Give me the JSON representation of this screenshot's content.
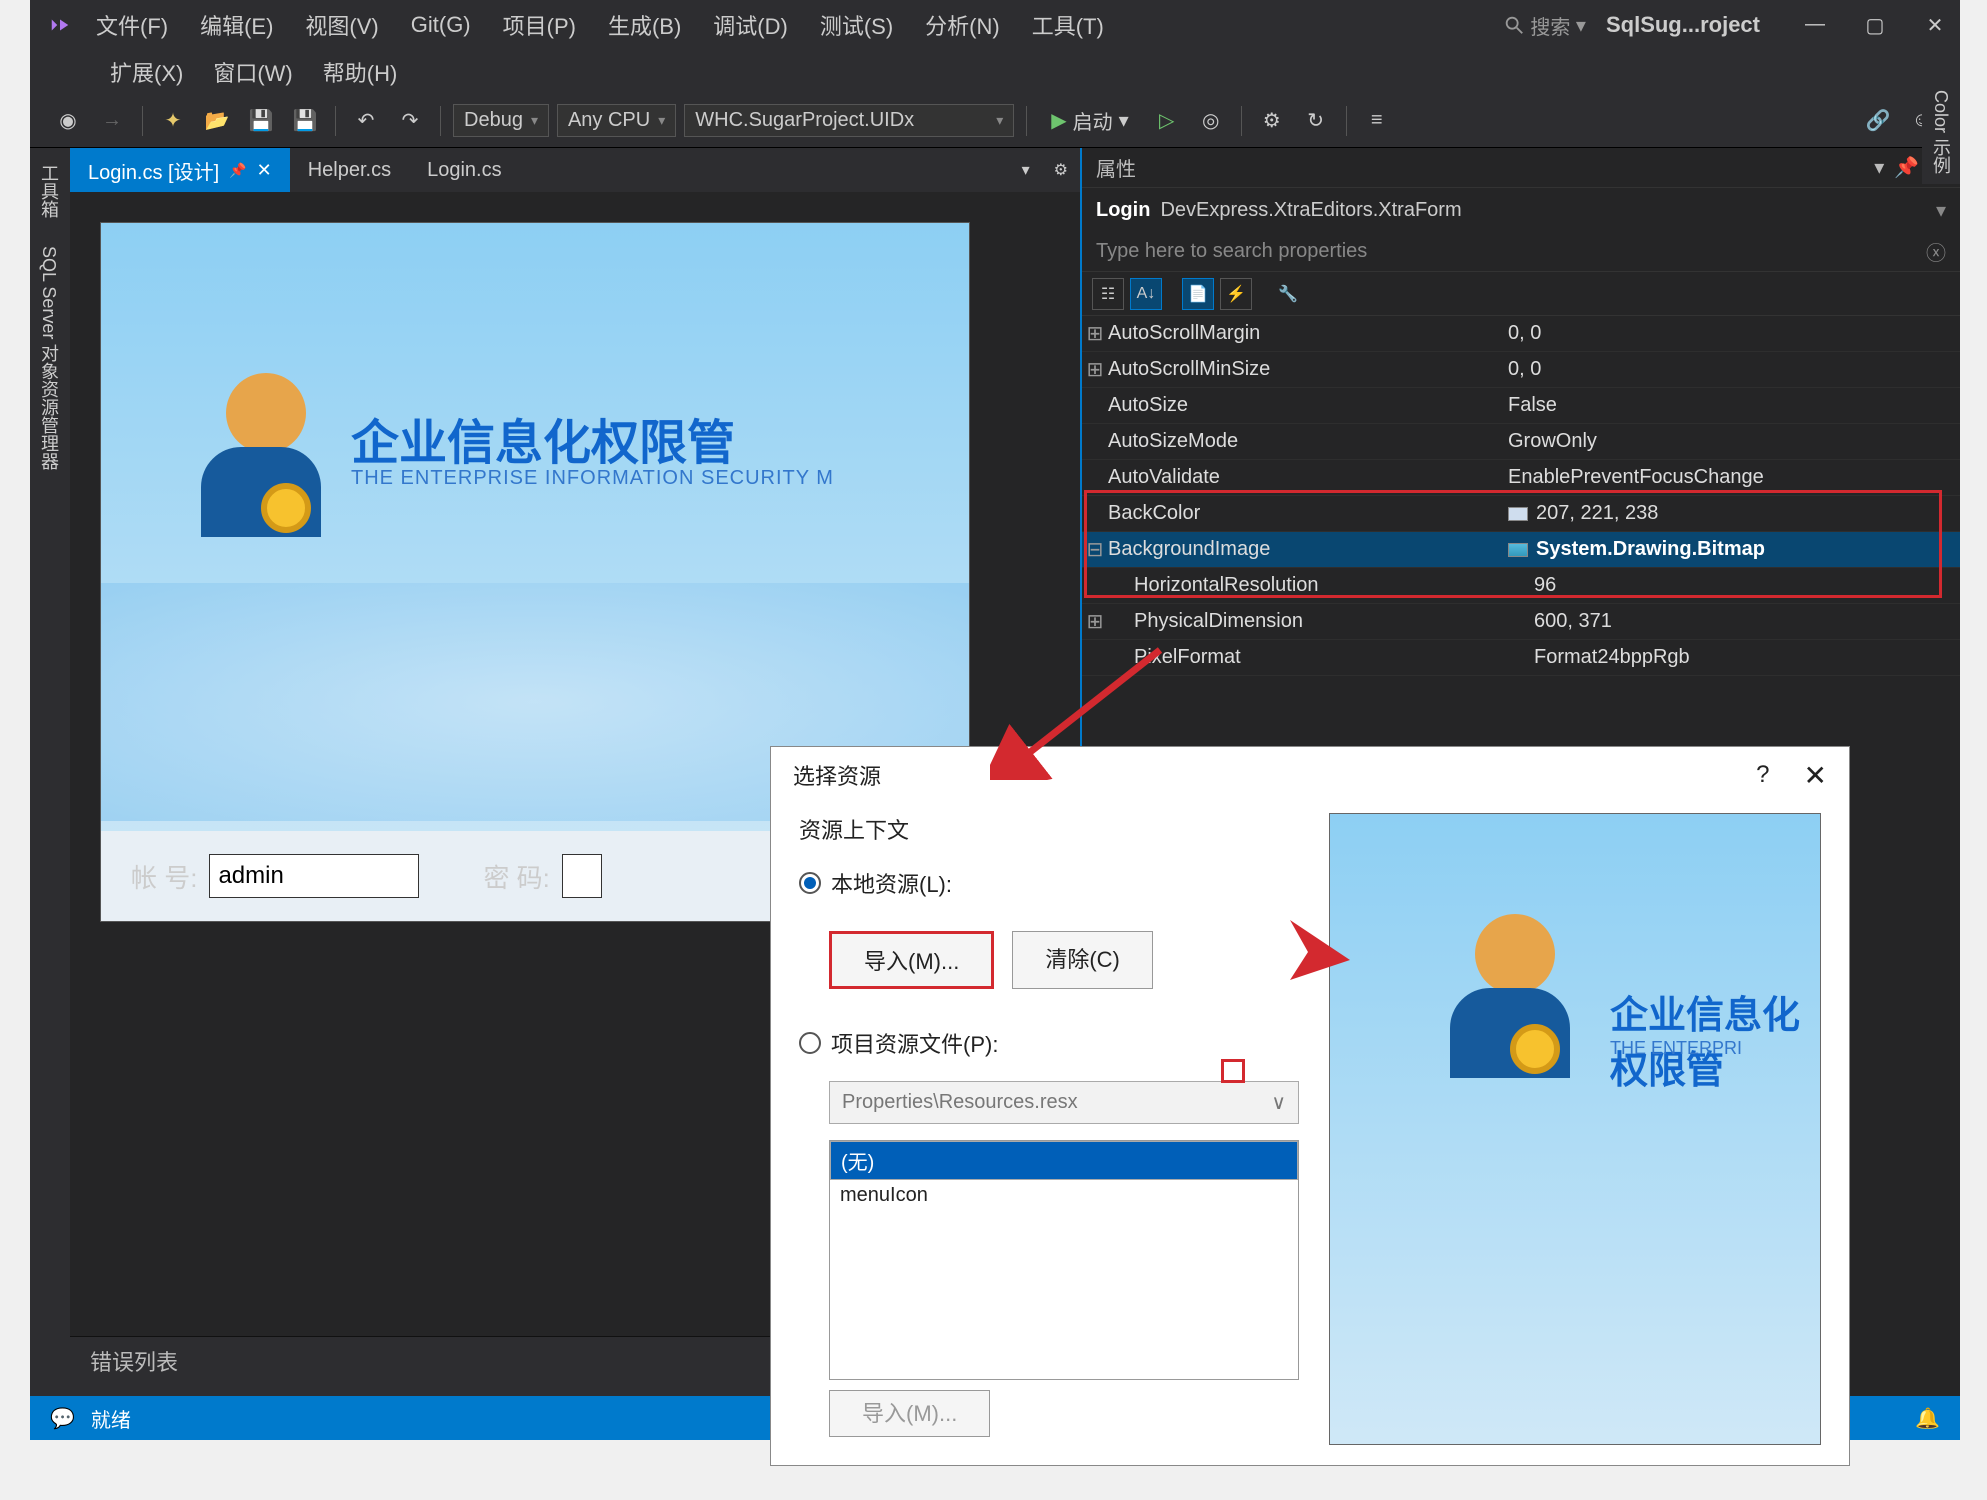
{
  "menu": {
    "items": [
      "文件(F)",
      "编辑(E)",
      "视图(V)",
      "Git(G)",
      "项目(P)",
      "生成(B)",
      "调试(D)",
      "测试(S)",
      "分析(N)",
      "工具(T)"
    ],
    "row2": [
      "扩展(X)",
      "窗口(W)",
      "帮助(H)"
    ],
    "search": "搜索"
  },
  "window": {
    "title": "SqlSug...roject"
  },
  "toolbar": {
    "config": "Debug",
    "platform": "Any CPU",
    "project": "WHC.SugarProject.UIDx",
    "start": "启动"
  },
  "tabs": {
    "items": [
      {
        "label": "Login.cs [设计]",
        "active": true
      },
      {
        "label": "Helper.cs",
        "active": false
      },
      {
        "label": "Login.cs",
        "active": false
      }
    ]
  },
  "leftrail": [
    "工具箱",
    "SQL Server 对象资源管理器"
  ],
  "rightrail": [
    "Color 示例"
  ],
  "designer": {
    "formTitle": "企业信息化权限管",
    "formSub": "THE ENTERPRISE INFORMATION SECURITY M",
    "labelUser": "帐  号:",
    "valueUser": "admin",
    "labelPass": "密  码:"
  },
  "properties": {
    "header": "属性",
    "objectName": "Login",
    "objectType": "DevExpress.XtraEditors.XtraForm",
    "searchPlaceholder": "Type here to search properties",
    "rows": [
      {
        "exp": "⊞",
        "name": "AutoScrollMargin",
        "value": "0, 0"
      },
      {
        "exp": "⊞",
        "name": "AutoScrollMinSize",
        "value": "0, 0"
      },
      {
        "exp": "",
        "name": "AutoSize",
        "value": "False"
      },
      {
        "exp": "",
        "name": "AutoSizeMode",
        "value": "GrowOnly"
      },
      {
        "exp": "",
        "name": "AutoValidate",
        "value": "EnablePreventFocusChange"
      },
      {
        "exp": "",
        "name": "BackColor",
        "value": "207, 221, 238",
        "swatch": "#cfddee"
      },
      {
        "exp": "⊟",
        "name": "BackgroundImage",
        "value": "System.Drawing.Bitmap",
        "selected": true,
        "bold": true,
        "icon": true
      },
      {
        "exp": "",
        "indent": true,
        "name": "HorizontalResolution",
        "value": "96"
      },
      {
        "exp": "⊞",
        "indent": true,
        "name": "PhysicalDimension",
        "value": "600, 371"
      },
      {
        "exp": "",
        "indent": true,
        "name": "PixelFormat",
        "value": "Format24bppRgb"
      }
    ]
  },
  "errorPanel": "错误列表",
  "dialog": {
    "title": "选择资源",
    "context": "资源上下文",
    "radioLocal": "本地资源(L):",
    "btnImport": "导入(M)...",
    "btnClear": "清除(C)",
    "radioProject": "项目资源文件(P):",
    "resourceFile": "Properties\\Resources.resx",
    "listItems": [
      "(无)",
      "menuIcon"
    ],
    "btnImport2": "导入(M)..."
  },
  "status": {
    "ready": "就绪"
  }
}
